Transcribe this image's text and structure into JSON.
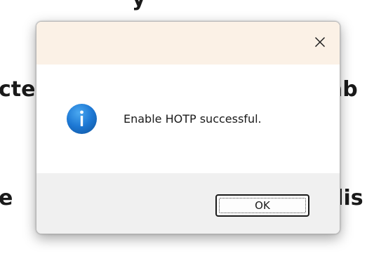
{
  "background": {
    "fragment_top": "y",
    "fragment_left_1": "cte",
    "fragment_right_1": "ab",
    "fragment_left_2": "e",
    "fragment_right_2": "dis"
  },
  "dialog": {
    "message": "Enable HOTP successful.",
    "ok_label": "OK",
    "icon": "info-icon",
    "close_icon": "close-icon",
    "colors": {
      "titlebar": "#fbf1e6",
      "footer": "#f0f0f0",
      "icon_blue": "#1d78d4"
    }
  }
}
